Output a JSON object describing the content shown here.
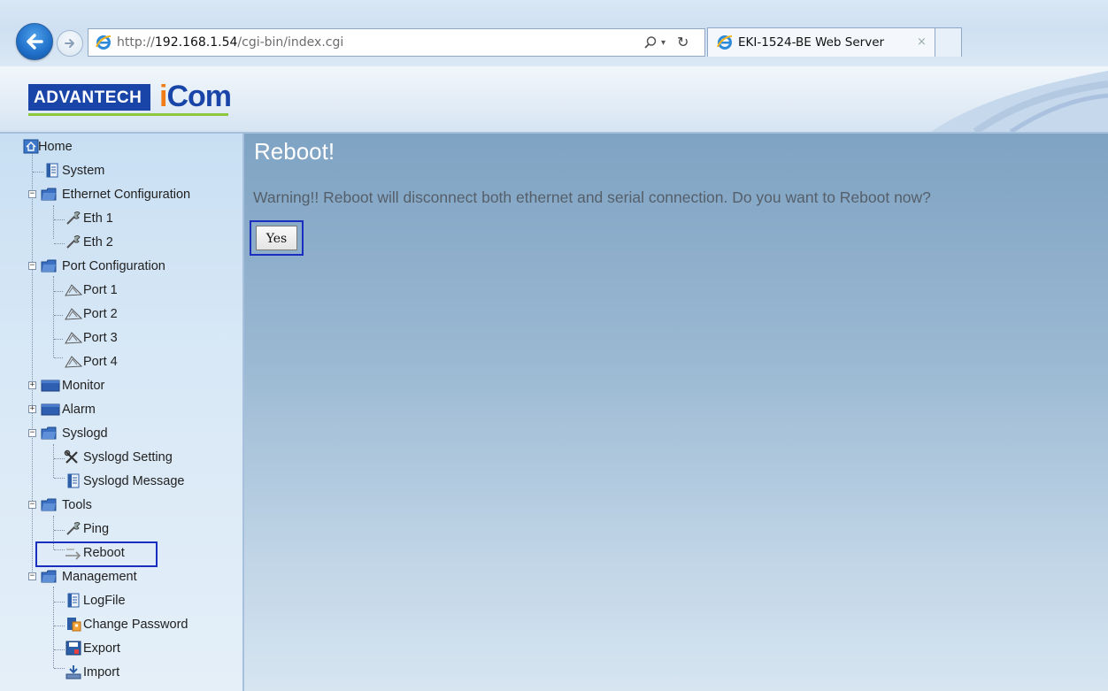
{
  "browser": {
    "url_prefix": "http://",
    "url_host": "192.168.1.54",
    "url_path": "/cgi-bin/index.cgi",
    "tab_title": "EKI-1524-BE Web Server",
    "tab_close": "×"
  },
  "banner": {
    "logo_left": "ADVANTECH",
    "logo_right_i": "i",
    "logo_right_rest": "Com"
  },
  "sidebar": {
    "items": [
      {
        "label": "Home",
        "icon": "home-icon"
      },
      {
        "label": "System",
        "icon": "document-icon"
      },
      {
        "label": "Ethernet Configuration",
        "icon": "folder-icon",
        "expanded": true
      },
      {
        "label": "Eth 1",
        "icon": "wrench-icon"
      },
      {
        "label": "Eth 2",
        "icon": "wrench-icon"
      },
      {
        "label": "Port Configuration",
        "icon": "folder-icon",
        "expanded": true
      },
      {
        "label": "Port 1",
        "icon": "port-icon"
      },
      {
        "label": "Port 2",
        "icon": "port-icon"
      },
      {
        "label": "Port 3",
        "icon": "port-icon"
      },
      {
        "label": "Port 4",
        "icon": "port-icon"
      },
      {
        "label": "Monitor",
        "icon": "folder-icon",
        "expanded": false
      },
      {
        "label": "Alarm",
        "icon": "folder-icon",
        "expanded": false
      },
      {
        "label": "Syslogd",
        "icon": "folder-icon",
        "expanded": true
      },
      {
        "label": "Syslogd Setting",
        "icon": "tools-icon"
      },
      {
        "label": "Syslogd Message",
        "icon": "document-icon"
      },
      {
        "label": "Tools",
        "icon": "folder-icon",
        "expanded": true
      },
      {
        "label": "Ping",
        "icon": "wrench-icon"
      },
      {
        "label": "Reboot",
        "icon": "reboot-icon",
        "selected": true
      },
      {
        "label": "Management",
        "icon": "folder-icon",
        "expanded": true
      },
      {
        "label": "LogFile",
        "icon": "document-icon"
      },
      {
        "label": "Change Password",
        "icon": "password-icon"
      },
      {
        "label": "Export",
        "icon": "save-icon"
      },
      {
        "label": "Import",
        "icon": "import-icon"
      }
    ]
  },
  "main": {
    "title": "Reboot!",
    "warning": "Warning!! Reboot will disconnect both ethernet and serial connection. Do you want to Reboot now?",
    "yes_label": "Yes"
  },
  "colors": {
    "brand_blue": "#1a45a8",
    "brand_orange": "#f07d18",
    "brand_green": "#8cc63e",
    "highlight": "#1a2fbf"
  }
}
